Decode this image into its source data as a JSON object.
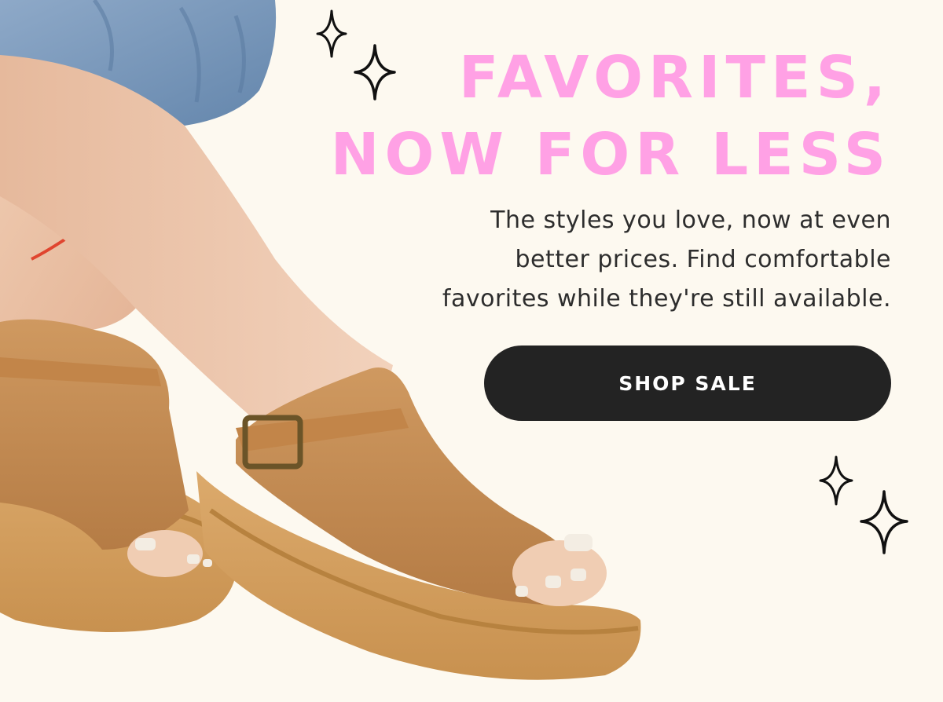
{
  "headline": {
    "line1": "FAVORITES,",
    "line2": "NOW FOR LESS"
  },
  "body": {
    "line1": "The styles you love, now at even",
    "line2": "better prices. Find comfortable",
    "line3": "favorites while they're still available."
  },
  "cta": {
    "label": "SHOP SALE"
  },
  "colors": {
    "background": "#fdf9f0",
    "headline": "#ffa1e5",
    "body_text": "#2d2d2d",
    "button": "#232323",
    "button_text": "#ffffff",
    "sandal_suede": "#c68d55"
  },
  "icons": [
    "sparkle-icon"
  ]
}
